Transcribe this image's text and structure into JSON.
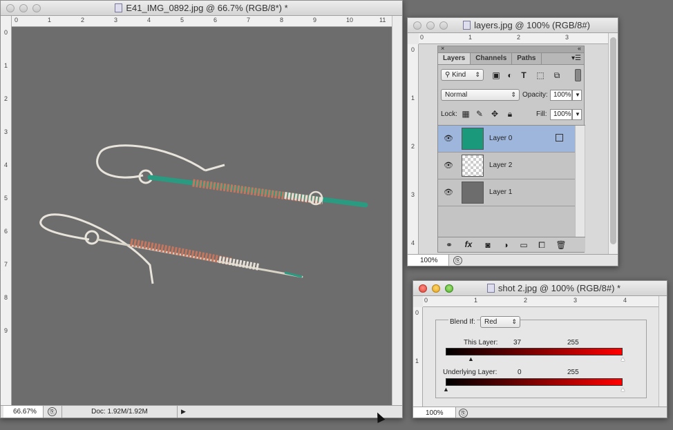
{
  "main_window": {
    "title": "E41_IMG_0892.jpg @ 66.7% (RGB/8*) *",
    "ruler_h": [
      "0",
      "1",
      "2",
      "3",
      "4",
      "5",
      "6",
      "7",
      "8",
      "9",
      "10",
      "11"
    ],
    "ruler_v": [
      "0",
      "1",
      "2",
      "3",
      "4",
      "5",
      "6",
      "7",
      "8",
      "9"
    ],
    "zoom": "66.67%",
    "doc_info": "Doc: 1.92M/1.92M"
  },
  "layers_window": {
    "title": "layers.jpg @ 100% (RGB/8#)",
    "ruler_h": [
      "0",
      "1",
      "2",
      "3"
    ],
    "ruler_v": [
      "0",
      "1",
      "2",
      "3",
      "4"
    ],
    "zoom": "100%"
  },
  "layers_panel": {
    "tabs": [
      "Layers",
      "Channels",
      "Paths"
    ],
    "kind_label": "Kind",
    "blend_mode": "Normal",
    "opacity_label": "Opacity:",
    "opacity_value": "100%",
    "lock_label": "Lock:",
    "fill_label": "Fill:",
    "fill_value": "100%",
    "layers": [
      {
        "name": "Layer 0",
        "selected": true,
        "thumb": "#1a9a7a"
      },
      {
        "name": "Layer 2",
        "selected": false,
        "thumb": "checker"
      },
      {
        "name": "Layer 1",
        "selected": false,
        "thumb": "#6d6d6d"
      }
    ],
    "footer_icons": [
      "link-icon",
      "fx-icon",
      "mask-icon",
      "adjustment-icon",
      "folder-icon",
      "new-layer-icon",
      "trash-icon"
    ]
  },
  "shot_window": {
    "title": "shot 2.jpg @ 100% (RGB/8#) *",
    "ruler_h": [
      "0",
      "1",
      "2",
      "3",
      "4"
    ],
    "ruler_v": [
      "0",
      "1"
    ],
    "zoom": "100%",
    "blend_if_label": "Blend If:",
    "blend_if_channel": "Red",
    "this_layer_label": "This Layer:",
    "this_layer_low": "37",
    "this_layer_high": "255",
    "underlying_label": "Underlying Layer:",
    "underlying_low": "0",
    "underlying_high": "255"
  },
  "colors": {
    "canvas": "#6e6e6e",
    "selected_row": "#9fb6dc",
    "red_gradient_end": "#ff0000"
  }
}
